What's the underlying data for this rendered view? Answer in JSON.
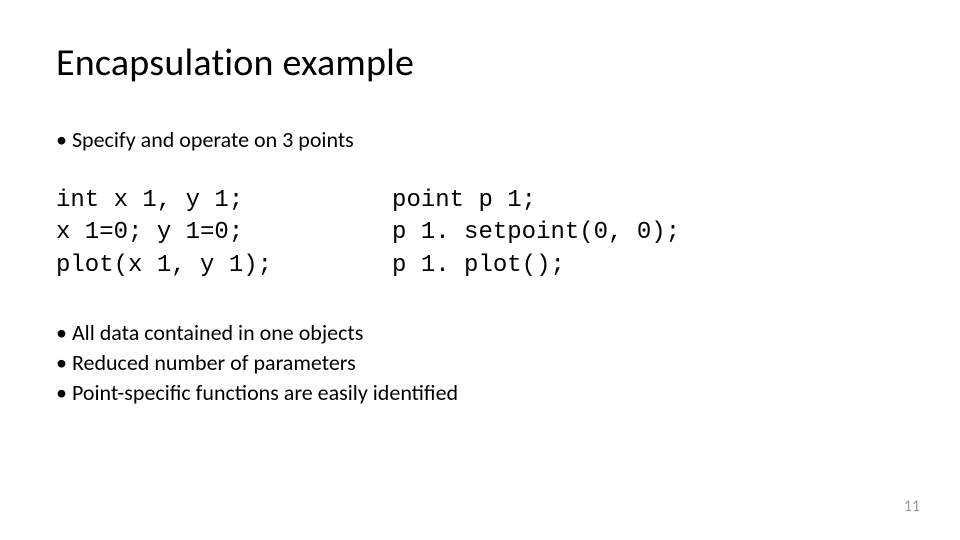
{
  "title": "Encapsulation example",
  "intro": "Specify and operate on 3 points",
  "code_left": "int x 1, y 1;\nx 1=0; y 1=0;\nplot(x 1, y 1);",
  "code_right": "point p 1;\np 1. setpoint(0, 0);\np 1. plot();",
  "notes": {
    "a": "All data contained in one objects",
    "b": "Reduced number of parameters",
    "c": "Point-specific functions are easily identified"
  },
  "page_number": "11"
}
